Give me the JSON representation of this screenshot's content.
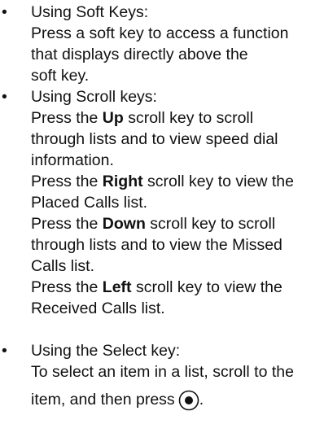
{
  "sections": [
    {
      "heading": "Using Soft Keys:",
      "lines": [
        "Press a soft key to access a function",
        "that displays directly above the",
        "soft key."
      ]
    },
    {
      "heading": "Using Scroll keys:",
      "up": {
        "l1_pre": "Press the ",
        "l1_key": "Up",
        "l1_post": " scroll key to scroll",
        "l2": "through lists and to view speed dial",
        "l3": "information."
      },
      "right": {
        "l1_pre": "Press the ",
        "l1_key": "Right",
        "l1_post": " scroll key to view the",
        "l2": "Placed Calls list."
      },
      "down": {
        "l1_pre": "Press the ",
        "l1_key": "Down",
        "l1_post": " scroll key to scroll",
        "l2": "through lists and to view the Missed",
        "l3": "Calls list."
      },
      "left": {
        "l1_pre": "Press the ",
        "l1_key": "Left",
        "l1_post": " scroll key to view the",
        "l2": "Received Calls list."
      }
    },
    {
      "heading": "Using the Select key:",
      "l1": "To select an item in a list, scroll to the",
      "l2_pre": "item, and then press",
      "l2_post": "."
    }
  ],
  "bullet_symbol": "•",
  "icons": {
    "select": "select-key-icon"
  }
}
